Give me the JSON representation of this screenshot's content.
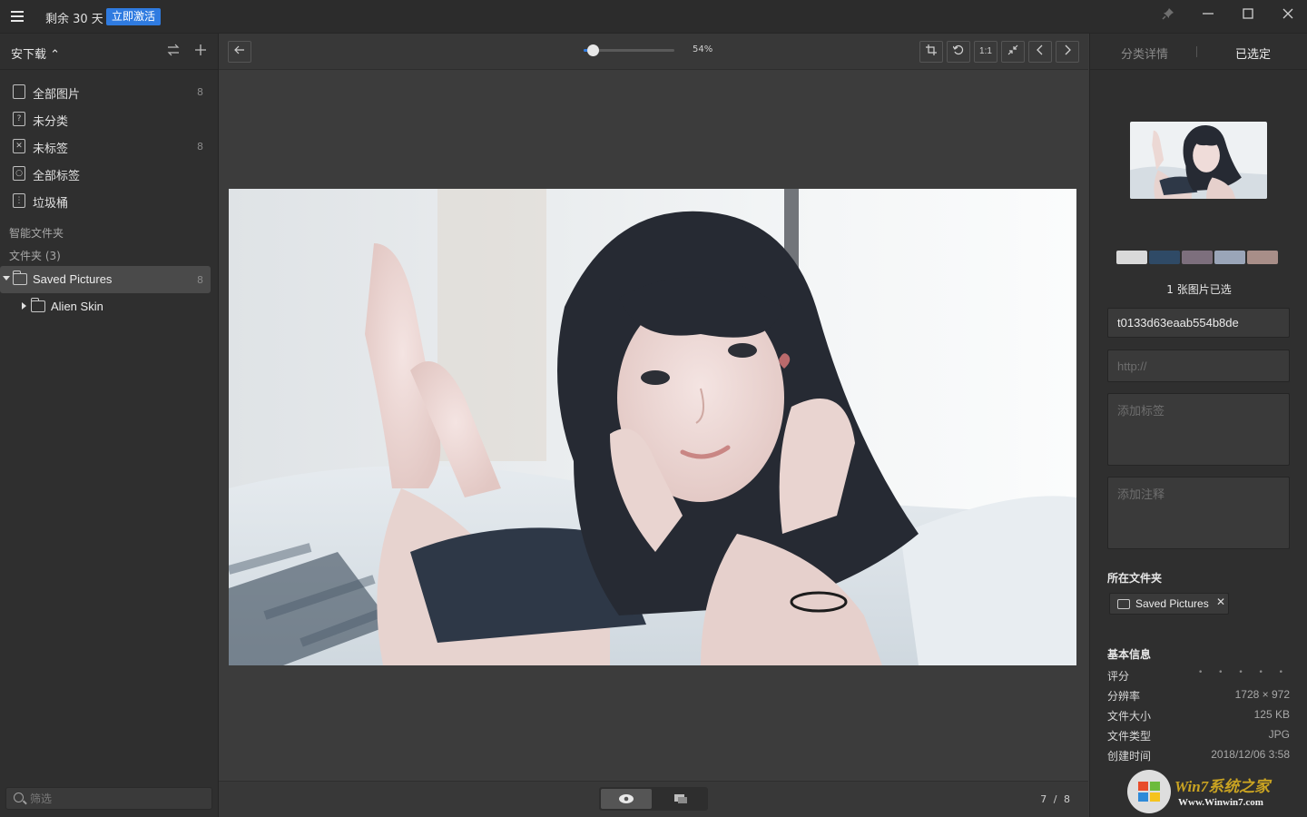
{
  "titlebar": {
    "trial_text": "剩余 30 天",
    "activate_label": "立即激活",
    "pin_icon": "pin-icon",
    "minimize": "—",
    "maximize": "☐",
    "close": "✕"
  },
  "sidebar": {
    "library_name": "安下载 ⌃",
    "items": [
      {
        "label": "全部图片",
        "count": "8",
        "icon": "image-stack-icon"
      },
      {
        "label": "未分类",
        "count": "",
        "icon": "question-file-icon"
      },
      {
        "label": "未标签",
        "count": "8",
        "icon": "untagged-icon"
      },
      {
        "label": "全部标签",
        "count": "",
        "icon": "tag-icon"
      },
      {
        "label": "垃圾桶",
        "count": "",
        "icon": "trash-icon"
      }
    ],
    "smart_folders_title": "智能文件夹",
    "folders_title": "文件夹 (3)",
    "folders": [
      {
        "label": "Saved Pictures",
        "count": "8"
      },
      {
        "label": "Alien Skin",
        "count": ""
      }
    ],
    "filter_placeholder": "筛选"
  },
  "viewer": {
    "zoom_label": "54%",
    "zoom_fraction": 0.1,
    "tool_1to1": "1:1",
    "page_counter": "7 / 8"
  },
  "right_panel": {
    "tabs": [
      "分类详情",
      "已选定"
    ],
    "swatches": [
      "#d9d9d9",
      "#2f4a66",
      "#7d6f7d",
      "#9aa5b8",
      "#a88e88"
    ],
    "selected_count": "1 张图片已选",
    "filename": "t0133d63eaab554b8de",
    "url_placeholder": "http://",
    "tags_placeholder": "添加标签",
    "notes_placeholder": "添加注释",
    "folder_heading": "所在文件夹",
    "folder_chip": "Saved Pictures",
    "basic_info_heading": "基本信息",
    "info": [
      {
        "key": "评分",
        "value": "• • • • •"
      },
      {
        "key": "分辨率",
        "value": "1728 × 972"
      },
      {
        "key": "文件大小",
        "value": "125 KB"
      },
      {
        "key": "文件类型",
        "value": "JPG"
      },
      {
        "key": "创建时间",
        "value": "2018/12/06 3:58"
      }
    ]
  },
  "watermark": {
    "brand": "Win7系统之家",
    "url": "Www.Winwin7.com"
  }
}
